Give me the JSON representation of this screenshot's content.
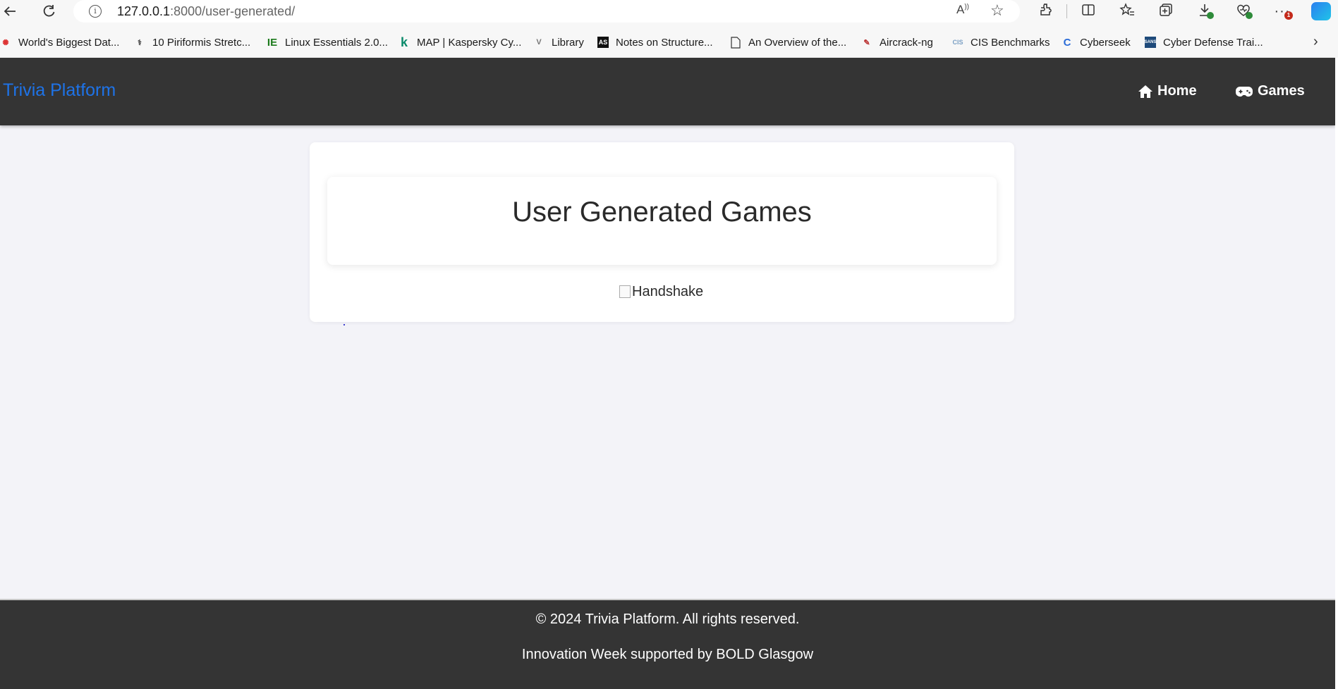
{
  "browser": {
    "url_host": "127.0.0.1",
    "url_rest": ":8000/user-generated/",
    "read_aloud": "A⁹",
    "bookmarks": [
      {
        "label": "World's Biggest Dat...",
        "icon": "colorful-dots-icon"
      },
      {
        "label": "10 Piriformis Stretc...",
        "icon": "caduceus-icon"
      },
      {
        "label": "Linux Essentials 2.0...",
        "icon": "ie-icon"
      },
      {
        "label": "MAP | Kaspersky Cy...",
        "icon": "kaspersky-icon"
      },
      {
        "label": "Library",
        "icon": "v-icon"
      },
      {
        "label": "Notes on Structure...",
        "icon": "as-icon"
      },
      {
        "label": "An Overview of the...",
        "icon": "document-icon"
      },
      {
        "label": "Aircrack-ng",
        "icon": "aircrack-icon"
      },
      {
        "label": "CIS Benchmarks",
        "icon": "cis-icon"
      },
      {
        "label": "Cyberseek",
        "icon": "cyberseek-icon"
      },
      {
        "label": "Cyber Defense Trai...",
        "icon": "sans-icon"
      }
    ],
    "download_badge": "",
    "menu_badge": "1"
  },
  "site": {
    "brand": "Trivia Platform",
    "nav": [
      {
        "label": "Home",
        "icon": "home-icon"
      },
      {
        "label": "Games",
        "icon": "gamepad-icon"
      }
    ]
  },
  "main": {
    "title": "User Generated Games",
    "image_alt": "Handshake"
  },
  "footer": {
    "copyright": "© 2024 Trivia Platform. All rights reserved.",
    "credit": "Innovation Week supported by BOLD Glasgow"
  },
  "colors": {
    "brand": "#1e73e8",
    "header_bg": "#343434",
    "page_bg": "#f3f3f8"
  }
}
